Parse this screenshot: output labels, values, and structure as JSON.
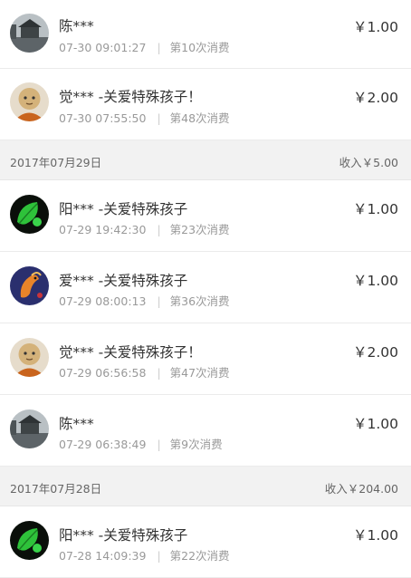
{
  "groups": [
    {
      "header": null,
      "items": [
        {
          "avatar": "lake-house-avatar",
          "name": "陈***",
          "time": "07-30 09:01:27",
          "count": "第10次消费",
          "amount": "￥1.00"
        },
        {
          "avatar": "monk-avatar",
          "name": "觉*** -关爱特殊孩子！",
          "time": "07-30 07:55:50",
          "count": "第48次消费",
          "amount": "￥2.00"
        }
      ]
    },
    {
      "header": {
        "date": "2017年07月29日",
        "income": "收入￥5.00"
      },
      "items": [
        {
          "avatar": "leaf-avatar",
          "name": "阳*** -关爱特殊孩子",
          "time": "07-29 19:42:30",
          "count": "第23次消费",
          "amount": "￥1.00"
        },
        {
          "avatar": "koi-avatar",
          "name": "爱*** -关爱特殊孩子",
          "time": "07-29 08:00:13",
          "count": "第36次消费",
          "amount": "￥1.00"
        },
        {
          "avatar": "monk-avatar",
          "name": "觉*** -关爱特殊孩子！",
          "time": "07-29 06:56:58",
          "count": "第47次消费",
          "amount": "￥2.00"
        },
        {
          "avatar": "lake-house-avatar",
          "name": "陈***",
          "time": "07-29 06:38:49",
          "count": "第9次消费",
          "amount": "￥1.00"
        }
      ]
    },
    {
      "header": {
        "date": "2017年07月28日",
        "income": "收入￥204.00"
      },
      "items": [
        {
          "avatar": "leaf-avatar",
          "name": "阳*** -关爱特殊孩子",
          "time": "07-28 14:09:39",
          "count": "第22次消费",
          "amount": "￥1.00"
        }
      ]
    }
  ]
}
